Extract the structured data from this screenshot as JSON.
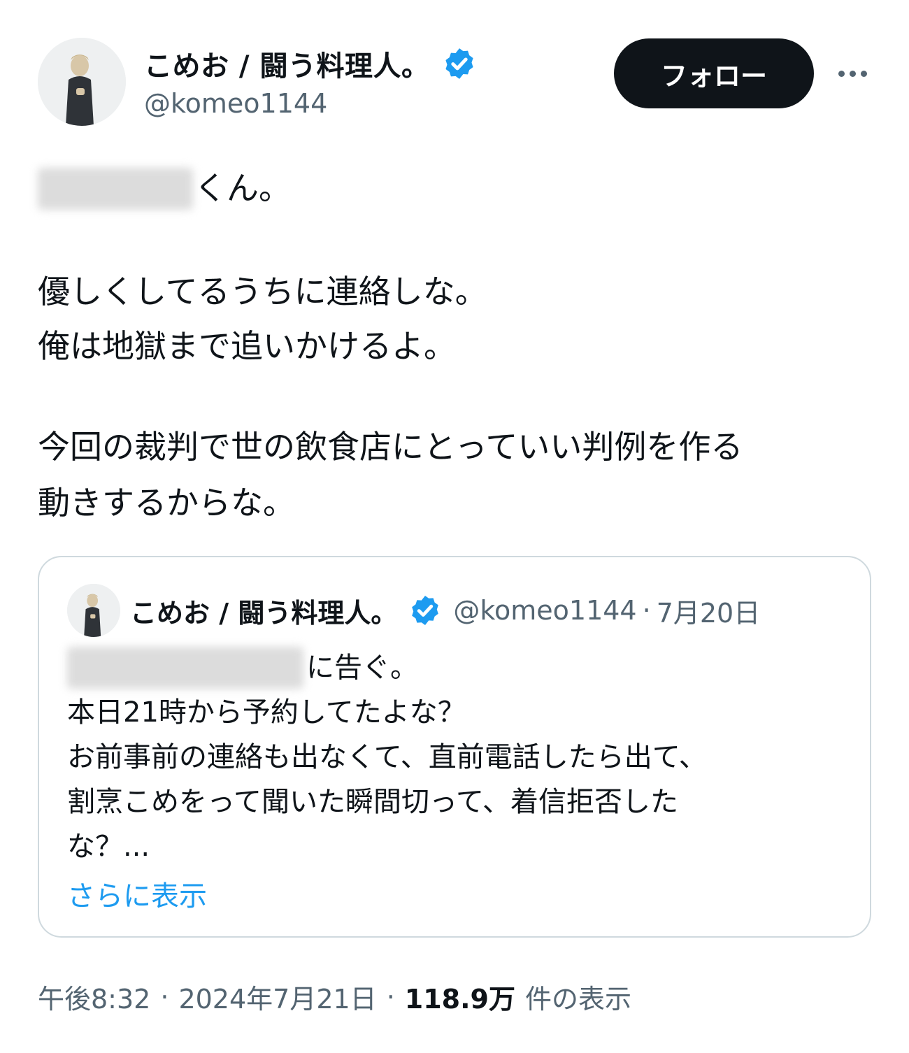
{
  "author": {
    "display_name": "こめお / 闘う料理人。",
    "handle": "@komeo1144",
    "verified_color": "#1d9bf0",
    "avatar_icon": "person-photo"
  },
  "actions": {
    "follow_label": "フォロー",
    "more_icon": "more-horizontal-icon"
  },
  "tweet": {
    "line0_suffix": "くん。",
    "line1": "優しくしてるうちに連絡しな。",
    "line2": "俺は地獄まで追いかけるよ。",
    "line3": "今回の裁判で世の飲食店にとっていい判例を作る",
    "line4": "動きするからな。"
  },
  "quote": {
    "display_name": "こめお / 闘う料理人。",
    "handle": "@komeo1144",
    "separator": "·",
    "date": "7月20日",
    "line0_suffix": "に告ぐ。",
    "line1": "本日21時から予約してたよな？",
    "line2": "お前事前の連絡も出なくて、直前電話したら出て、",
    "line3": "割烹こめをって聞いた瞬間切って、着信拒否した",
    "line4": "な？...",
    "show_more": "さらに表示"
  },
  "meta": {
    "time": "午後8:32",
    "separator": "·",
    "date": "2024年7月21日",
    "views_count": "118.9万",
    "views_label": "件の表示"
  },
  "colors": {
    "text": "#0f1419",
    "secondary": "#536471",
    "link": "#1d9bf0",
    "border": "#cfd9de",
    "button_bg": "#0f1419"
  }
}
